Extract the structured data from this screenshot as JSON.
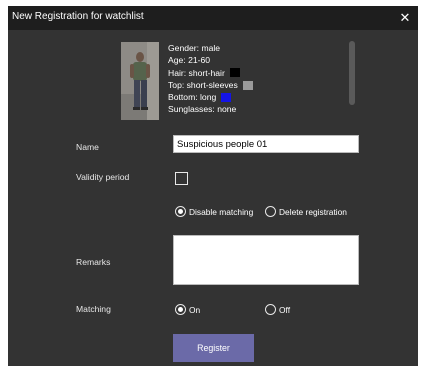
{
  "dialog": {
    "title": "New Registration for watchlist",
    "close_glyph": "✕"
  },
  "person_attributes": {
    "gender": "Gender: male",
    "age": "Age: 21-60",
    "hair": "Hair: short-hair",
    "hair_color": "#000000",
    "top": "Top: short-sleeves",
    "top_color": "#9a9a9a",
    "bottom": "Bottom: long",
    "bottom_color": "#1414e6",
    "sunglasses": "Sunglasses: none"
  },
  "form": {
    "name_label": "Name",
    "name_value": "Suspicious people 01",
    "validity_label": "Validity period",
    "validity_checked": false,
    "disable_matching_label": "Disable matching",
    "delete_registration_label": "Delete registration",
    "expiry_action_selected": "Disable matching",
    "remarks_label": "Remarks",
    "remarks_value": "",
    "matching_label": "Matching",
    "matching_on_label": "On",
    "matching_off_label": "Off",
    "matching_selected": "On",
    "register_label": "Register"
  },
  "colors": {
    "dialog_bg": "#333333",
    "titlebar_bg": "#1e1e1e",
    "accent_button": "#6b6aa8"
  },
  "icons": {
    "close": "close-icon",
    "person_thumbnail": "person-thumbnail"
  }
}
